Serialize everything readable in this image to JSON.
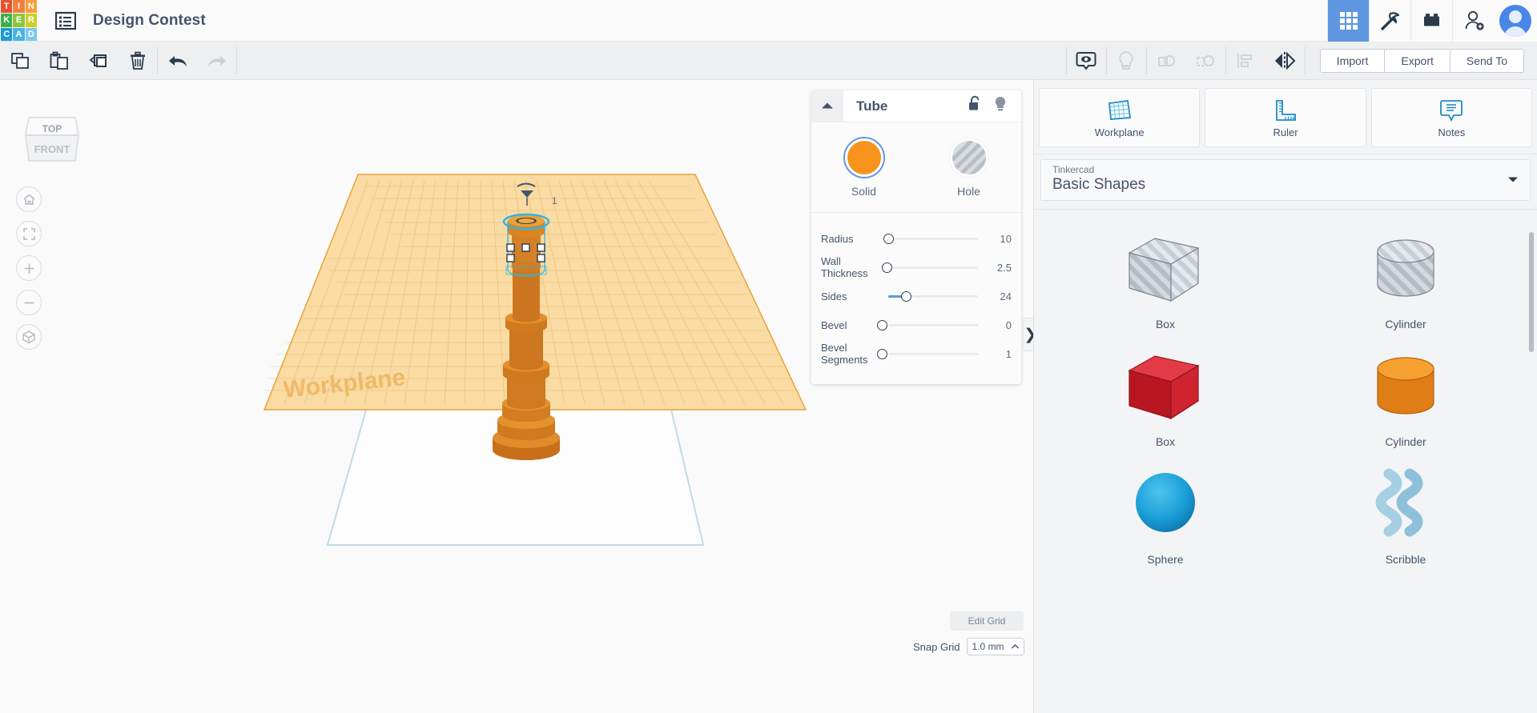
{
  "app": {
    "logo_tiles": [
      {
        "letter": "T",
        "color": "#e8502e"
      },
      {
        "letter": "I",
        "color": "#f5803c"
      },
      {
        "letter": "N",
        "color": "#f9a03c"
      },
      {
        "letter": "K",
        "color": "#3fae49"
      },
      {
        "letter": "E",
        "color": "#8cc63f"
      },
      {
        "letter": "R",
        "color": "#c8d02c"
      },
      {
        "letter": "C",
        "color": "#1a9bd7"
      },
      {
        "letter": "A",
        "color": "#4ab3e3"
      },
      {
        "letter": "D",
        "color": "#7ec8ec"
      }
    ],
    "menu_icon": "list-menu-icon",
    "document_title": "Design Contest"
  },
  "topbar_right": {
    "items": [
      {
        "name": "tinkercad-3d-designs",
        "icon": "grid-icon",
        "active": true
      },
      {
        "name": "minecraft",
        "icon": "pickaxe-icon",
        "active": false
      },
      {
        "name": "blocks",
        "icon": "lego-brick-icon",
        "active": false
      },
      {
        "name": "invite-people",
        "icon": "add-user-icon",
        "active": false
      }
    ],
    "avatar": "user-avatar"
  },
  "toolbar": {
    "left_tools": [
      {
        "name": "copy",
        "icon": "copy-icon"
      },
      {
        "name": "paste",
        "icon": "paste-icon"
      },
      {
        "name": "duplicate",
        "icon": "duplicate-icon"
      },
      {
        "name": "delete",
        "icon": "trash-icon"
      }
    ],
    "history_tools": [
      {
        "name": "undo",
        "icon": "undo-arrow-icon",
        "disabled": false
      },
      {
        "name": "redo",
        "icon": "redo-arrow-icon",
        "disabled": true
      }
    ],
    "center_tools": [
      {
        "name": "show-hide",
        "icon": "eye-bubble-icon",
        "disabled": false
      },
      {
        "name": "light",
        "icon": "lightbulb-icon",
        "disabled": true
      },
      {
        "name": "group",
        "icon": "group-shapes-icon",
        "disabled": true
      },
      {
        "name": "ungroup",
        "icon": "ungroup-shapes-icon",
        "disabled": true
      },
      {
        "name": "align",
        "icon": "align-icon",
        "disabled": true
      },
      {
        "name": "mirror",
        "icon": "mirror-flip-icon",
        "disabled": false
      }
    ],
    "actions": [
      {
        "name": "import",
        "label": "Import"
      },
      {
        "name": "export",
        "label": "Export"
      },
      {
        "name": "send-to",
        "label": "Send To"
      }
    ]
  },
  "canvas": {
    "workplane_label": "Workplane",
    "dimension_label": "1",
    "view_cube": {
      "top": "TOP",
      "front": "FRONT"
    },
    "nav_controls": [
      {
        "name": "home-view",
        "icon": "home-icon"
      },
      {
        "name": "fit-all-view",
        "icon": "fit-frame-icon"
      },
      {
        "name": "zoom-in",
        "icon": "plus-icon"
      },
      {
        "name": "zoom-out",
        "icon": "minus-icon"
      },
      {
        "name": "toggle-orthographic",
        "icon": "cube-perspective-icon"
      }
    ],
    "edit_grid_label": "Edit Grid",
    "snap_grid_label": "Snap Grid",
    "snap_grid_value": "1.0 mm",
    "colors": {
      "workplane_fill": "#f8d79a",
      "workplane_line": "#e8a33d",
      "shape_orange": "#d4761c",
      "selection_blue": "#2ab7e6",
      "ghost_plane": "#bfdce8"
    }
  },
  "properties": {
    "title": "Tube",
    "collapse_icon": "chevron-up-icon",
    "head_icons": [
      {
        "name": "lock-shape",
        "icon": "unlocked-padlock-icon"
      },
      {
        "name": "hide-shape",
        "icon": "lightbulb-icon"
      }
    ],
    "modes": [
      {
        "name": "solid",
        "label": "Solid",
        "selected": true,
        "color": "#f7941e"
      },
      {
        "name": "hole",
        "label": "Hole",
        "selected": false
      }
    ],
    "sliders": [
      {
        "name": "radius",
        "label": "Radius",
        "value": "10",
        "fill_pct": 0,
        "knob_pct": 0
      },
      {
        "name": "wall-thickness",
        "label": "Wall Thickness",
        "value": "2.5",
        "fill_pct": 0,
        "knob_pct": 0
      },
      {
        "name": "sides",
        "label": "Sides",
        "value": "24",
        "fill_pct": 27,
        "knob_pct": 27
      },
      {
        "name": "bevel",
        "label": "Bevel",
        "value": "0",
        "fill_pct": 0,
        "knob_pct": 0
      },
      {
        "name": "bevel-segments",
        "label": "Bevel Segments",
        "value": "1",
        "fill_pct": 0,
        "knob_pct": 0
      }
    ],
    "expand_tab_glyph": "❯"
  },
  "right_panel": {
    "tools": [
      {
        "name": "workplane",
        "label": "Workplane",
        "icon": "workplane-grid-icon"
      },
      {
        "name": "ruler",
        "label": "Ruler",
        "icon": "ruler-icon"
      },
      {
        "name": "notes",
        "label": "Notes",
        "icon": "notes-bubble-icon"
      }
    ],
    "library_select": {
      "sub_label": "Tinkercad",
      "main_label": "Basic Shapes",
      "caret": "chevron-down-icon"
    },
    "shapes": [
      {
        "name": "box-hole",
        "label": "Box",
        "kind": "box",
        "style": "hole"
      },
      {
        "name": "cylinder-hole",
        "label": "Cylinder",
        "kind": "cylinder",
        "style": "hole"
      },
      {
        "name": "box-red",
        "label": "Box",
        "kind": "box",
        "style": "solid",
        "color": "#d5232f"
      },
      {
        "name": "cylinder-orange",
        "label": "Cylinder",
        "kind": "cylinder",
        "style": "solid",
        "color": "#f08a1e"
      },
      {
        "name": "sphere-blue",
        "label": "Sphere",
        "kind": "sphere",
        "style": "solid",
        "color": "#1b9fd8"
      },
      {
        "name": "scribble",
        "label": "Scribble",
        "kind": "scribble",
        "style": "solid",
        "color": "#a7cfe4"
      }
    ]
  }
}
